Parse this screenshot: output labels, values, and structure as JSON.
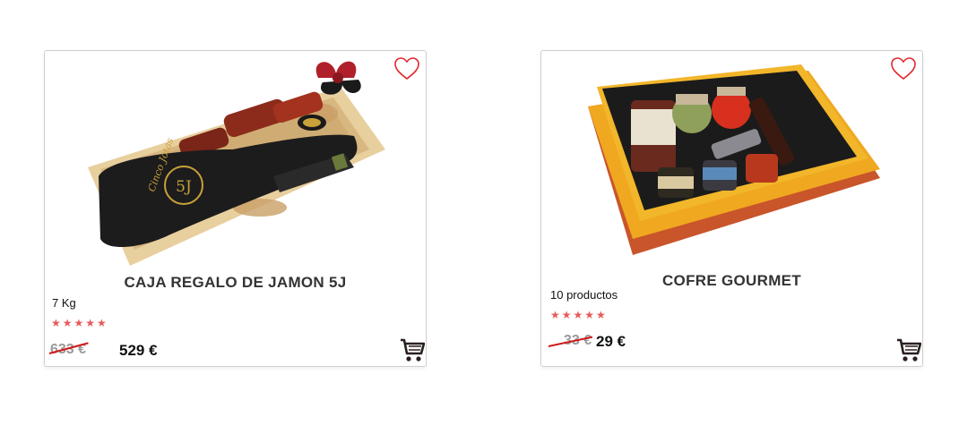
{
  "products": [
    {
      "name": "CAJA REGALO DE JAMON 5J",
      "detail": "7 Kg",
      "rating": "★★★★★",
      "old_price": "633 €",
      "price": "529 €",
      "image_icon": "jamon-gift-box-image",
      "brand_mark": "5J",
      "signature": "Cinco Jotas"
    },
    {
      "name": "COFRE GOURMET",
      "detail": "10 productos",
      "rating": "★★★★★",
      "old_price": "33 €",
      "price": "29 €",
      "image_icon": "gourmet-box-image"
    }
  ],
  "colors": {
    "heart": "#e0262c",
    "stars": "#e85a5a",
    "strike": "#d01919",
    "cart": "#2a1f1f"
  },
  "icons": [
    "heart-icon",
    "cart-icon",
    "star-icon"
  ]
}
